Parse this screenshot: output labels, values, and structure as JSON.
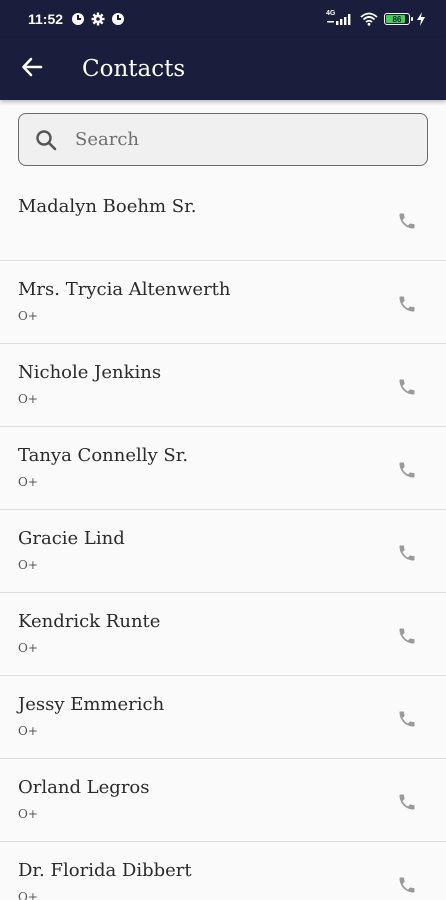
{
  "status_bar": {
    "time": "11:52",
    "network": "4G",
    "battery": "86",
    "battery_level_percent": 86,
    "icons": [
      "notification-icon",
      "settings-gear-icon",
      "notification-icon",
      "signal-icon",
      "wifi-icon",
      "battery-icon",
      "charging-bolt-icon"
    ]
  },
  "app_bar": {
    "title": "Contacts",
    "back_icon": "arrow-left-icon"
  },
  "search": {
    "placeholder": "Search",
    "value": "",
    "icon": "search-icon"
  },
  "contacts": [
    {
      "name": "Madalyn Boehm Sr.",
      "subtitle": ""
    },
    {
      "name": "Mrs. Trycia Altenwerth",
      "subtitle": "O+"
    },
    {
      "name": "Nichole Jenkins",
      "subtitle": "O+"
    },
    {
      "name": "Tanya Connelly Sr.",
      "subtitle": "O+"
    },
    {
      "name": "Gracie Lind",
      "subtitle": "O+"
    },
    {
      "name": "Kendrick Runte",
      "subtitle": "O+"
    },
    {
      "name": "Jessy Emmerich",
      "subtitle": "O+"
    },
    {
      "name": "Orland Legros",
      "subtitle": "O+"
    },
    {
      "name": "Dr. Florida Dibbert",
      "subtitle": "O+"
    }
  ],
  "colors": {
    "app_bar": "#1a1d3b",
    "background": "#fafafa",
    "divider": "#dedede",
    "phone_icon": "#9a9a9a",
    "battery_fill": "#3fd34b"
  }
}
